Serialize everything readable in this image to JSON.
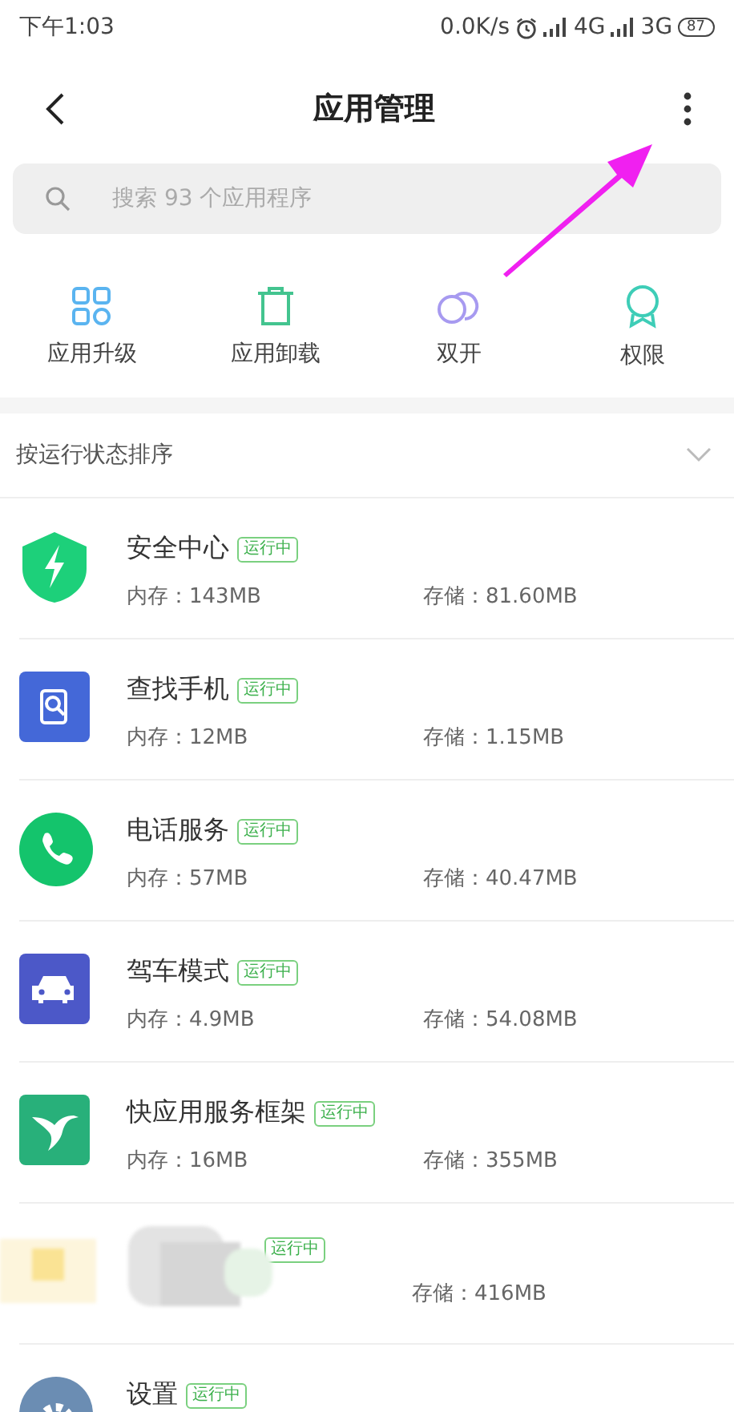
{
  "status_bar": {
    "time": "下午1:03",
    "speed": "0.0K/s",
    "network_1": "4G",
    "network_2": "3G",
    "battery": "87"
  },
  "header": {
    "title": "应用管理"
  },
  "search": {
    "placeholder": "搜索 93 个应用程序"
  },
  "actions": [
    {
      "label": "应用升级"
    },
    {
      "label": "应用卸载"
    },
    {
      "label": "双开"
    },
    {
      "label": "权限"
    }
  ],
  "sort": {
    "label": "按运行状态排序"
  },
  "apps": [
    {
      "kind": "app",
      "name": "安全中心",
      "badge": "运行中",
      "memory": "内存：143MB",
      "storage": "存储：81.60MB"
    },
    {
      "kind": "app",
      "name": "查找手机",
      "badge": "运行中",
      "memory": "内存：12MB",
      "storage": "存储：1.15MB"
    },
    {
      "kind": "app",
      "name": "电话服务",
      "badge": "运行中",
      "memory": "内存：57MB",
      "storage": "存储：40.47MB"
    },
    {
      "kind": "app",
      "name": "驾车模式",
      "badge": "运行中",
      "memory": "内存：4.9MB",
      "storage": "存储：54.08MB"
    },
    {
      "kind": "app",
      "name": "快应用服务框架",
      "badge": "运行中",
      "memory": "内存：16MB",
      "storage": "存储：355MB"
    },
    {
      "kind": "blurred",
      "badge": "运行中",
      "storage": "存储：416MB"
    },
    {
      "kind": "app",
      "name": "设置",
      "badge": "运行中"
    }
  ]
}
